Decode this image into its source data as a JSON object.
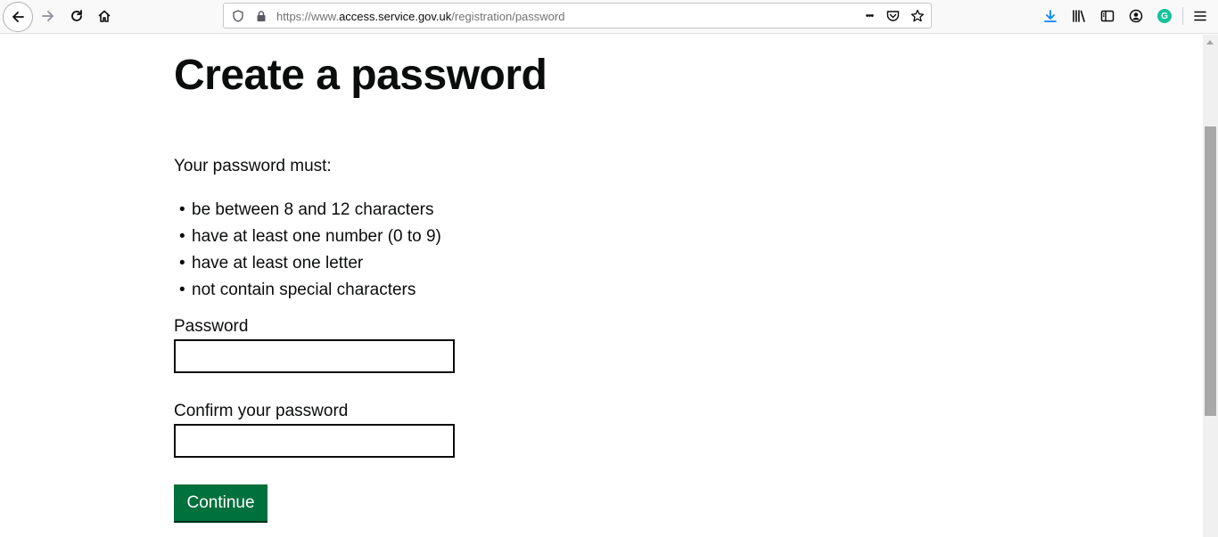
{
  "browser": {
    "url_prefix": "https://www.",
    "url_host": "access.service.gov.uk",
    "url_path": "/registration/password",
    "overflow_menu_label": "•••",
    "grammarly_label": "G"
  },
  "page": {
    "title": "Create a password",
    "intro": "Your password must:",
    "bullet": "•",
    "rules": [
      "be between 8 and 12 characters",
      "have at least one number (0 to 9)",
      "have at least one letter",
      "not contain special characters"
    ],
    "password_label": "Password",
    "password_value": "",
    "confirm_label": "Confirm your password",
    "confirm_value": "",
    "continue_label": "Continue"
  },
  "colors": {
    "button_green": "#00703c",
    "text": "#0b0c0c",
    "download_blue": "#0a84ff",
    "grammarly_green": "#15c39a"
  }
}
